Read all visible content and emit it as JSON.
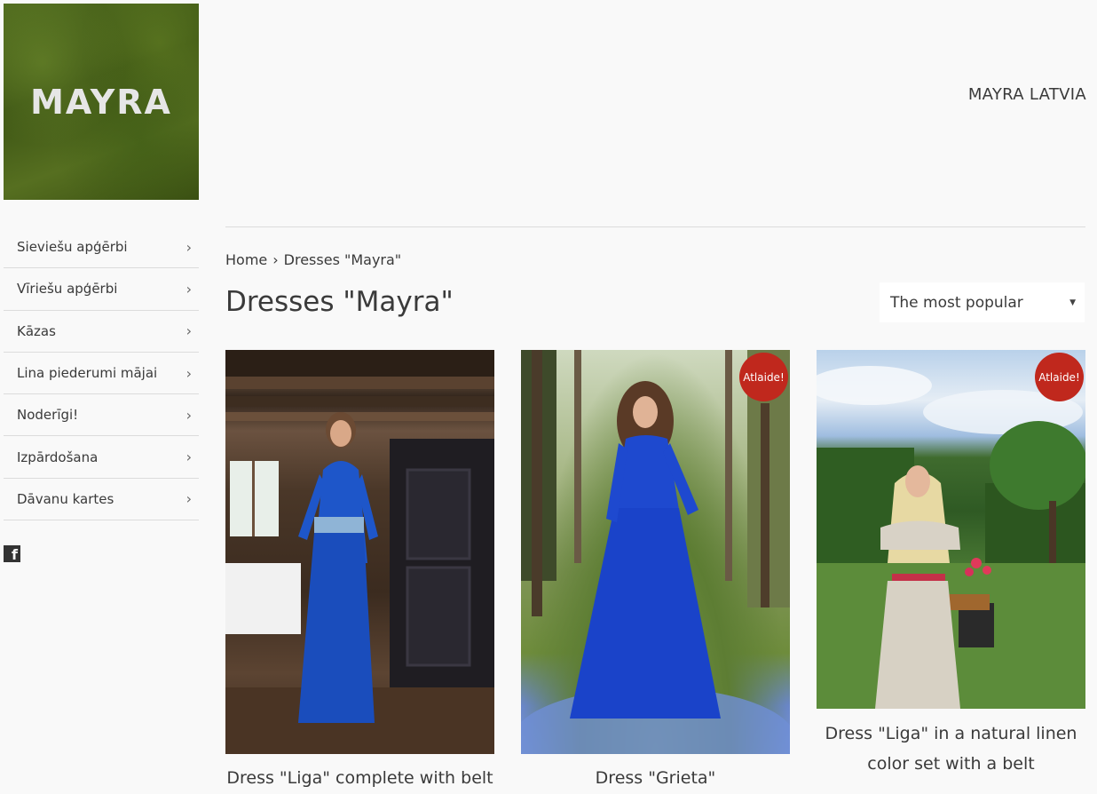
{
  "header": {
    "logo_text": "MAYRA",
    "store_name": "MAYRA LATVIA"
  },
  "sidebar": {
    "items": [
      {
        "label": "Sieviešu apģērbi"
      },
      {
        "label": "Vīriešu apģērbi"
      },
      {
        "label": "Kāzas"
      },
      {
        "label": "Lina piederumi mājai"
      },
      {
        "label": "Noderīgi!"
      },
      {
        "label": "Izpārdošana"
      },
      {
        "label": "Dāvanu kartes"
      }
    ],
    "chevron": "›",
    "social_icon": "facebook-icon"
  },
  "breadcrumb": {
    "home": "Home",
    "separator": "›",
    "current": "Dresses \"Mayra\""
  },
  "collection": {
    "title": "Dresses \"Mayra\"",
    "sort_selected": "The most popular"
  },
  "products": [
    {
      "title": "Dress \"Liga\" complete with belt",
      "badge": ""
    },
    {
      "title": "Dress \"Grieta\"",
      "badge": "Atlaide!"
    },
    {
      "title_line1": "Dress \"Liga\" in a natural linen",
      "title_line2": "color set with a belt",
      "badge": "Atlaide!"
    }
  ],
  "colors": {
    "background": "#f9f9f9",
    "badge": "#c0281d",
    "text": "#3a3a3a"
  }
}
